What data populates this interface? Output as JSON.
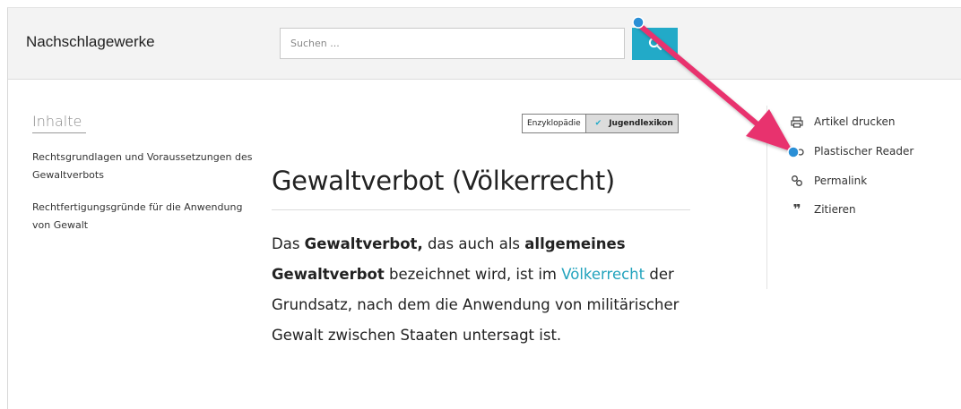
{
  "header": {
    "brand": "Nachschlagewerke",
    "search_placeholder": "Suchen ..."
  },
  "toc": {
    "title": "Inhalte",
    "items": [
      "Rechtsgrundlagen und Voraussetzungen des Gewaltverbots",
      "Rechtfertigungsgründe für die Anwendung von Gewalt"
    ]
  },
  "edition_switch": {
    "option_1": "Enzyklopädie",
    "option_2": "Jugendlexikon",
    "selected": "Jugendlexikon"
  },
  "article": {
    "title": "Gewaltverbot (Völkerrecht)",
    "p1": "Das ",
    "b1": "Gewaltverbot,",
    "p2": " das auch als ",
    "b2": "allgemeines Gewaltverbot",
    "p3": " bezeichnet wird, ist im ",
    "link": "Völkerrecht",
    "p4": " der Grundsatz, nach dem die Anwendung von militärischer Gewalt zwischen Staaten untersagt ist."
  },
  "actions": [
    {
      "label": "Artikel drucken",
      "icon": "printer-icon"
    },
    {
      "label": "Plastischer Reader",
      "icon": "glasses-icon"
    },
    {
      "label": "Permalink",
      "icon": "link-icon"
    },
    {
      "label": "Zitieren",
      "icon": "quote-icon"
    }
  ],
  "colors": {
    "accent": "#22aac8",
    "annotation_arrow": "#e8326e",
    "annotation_dot": "#2a8fd6"
  }
}
